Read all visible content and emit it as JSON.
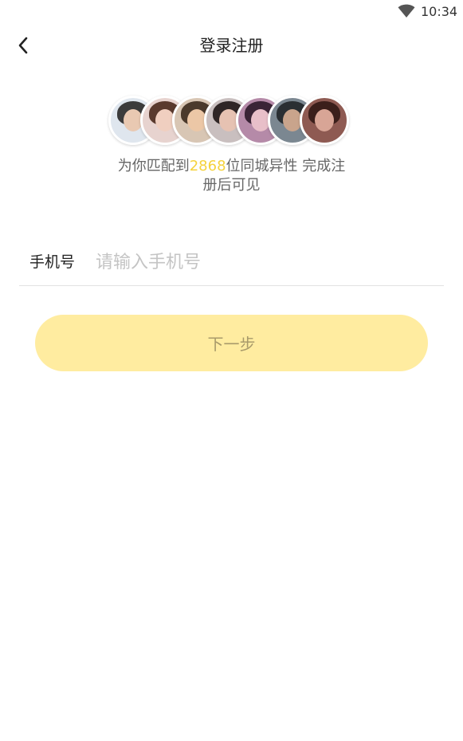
{
  "status_bar": {
    "time": "10:34",
    "wifi_icon": "wifi-icon"
  },
  "header": {
    "title": "登录注册",
    "back_icon": "chevron-left-icon"
  },
  "avatars": [
    {
      "name": "avatar-1",
      "bg": "#dfe6ee",
      "hair": "#3b3b3b",
      "skin": "#e9c9b2"
    },
    {
      "name": "avatar-2",
      "bg": "#e7d3cf",
      "hair": "#5a3a2e",
      "skin": "#f0cfc0"
    },
    {
      "name": "avatar-3",
      "bg": "#d8c6b4",
      "hair": "#4b3a2c",
      "skin": "#ecc7a6"
    },
    {
      "name": "avatar-4",
      "bg": "#c9bfbf",
      "hair": "#2f2626",
      "skin": "#e6c2b2"
    },
    {
      "name": "avatar-5",
      "bg": "#b58aa8",
      "hair": "#3a2436",
      "skin": "#e8bfc9"
    },
    {
      "name": "avatar-6",
      "bg": "#7b8791",
      "hair": "#2a2f33",
      "skin": "#c9a48c"
    },
    {
      "name": "avatar-7",
      "bg": "#8e5a52",
      "hair": "#3b1f1b",
      "skin": "#d8a596"
    }
  ],
  "match": {
    "prefix": "为你匹配到",
    "count": "2868",
    "suffix": "位同城异性 完成注册后可见",
    "count_color": "#f5d23c"
  },
  "phone": {
    "label": "手机号",
    "placeholder": "请输入手机号",
    "value": ""
  },
  "next_button": {
    "label": "下一步",
    "bg_color": "#ffeca0"
  }
}
